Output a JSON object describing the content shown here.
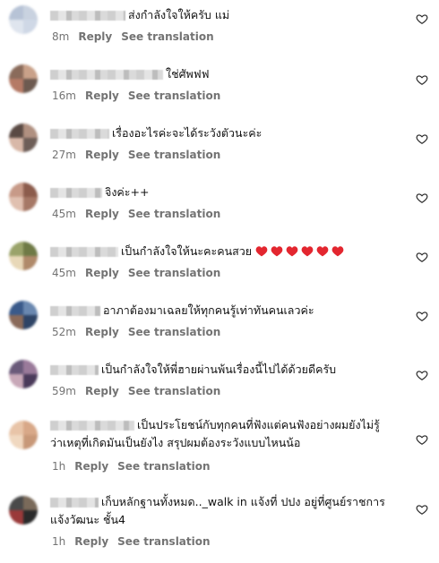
{
  "actions": {
    "reply": "Reply",
    "see_translation": "See translation"
  },
  "comments": [
    {
      "text": "ส่งกำลังใจให้ครับ แม่",
      "time": "8m",
      "avatar": [
        "#b7c3d6",
        "#c9d2e0",
        "#dfe5ee",
        "#cfd8e6"
      ]
    },
    {
      "text": "ใช่ศัพฟฟ",
      "time": "16m",
      "avatar": [
        "#8a6b5b",
        "#c9a189",
        "#b57a66",
        "#6d5a50"
      ]
    },
    {
      "text": "เรื่องอะไรค่ะจะได้ระวังตัวนะค่ะ",
      "time": "27m",
      "avatar": [
        "#5a4a44",
        "#b09080",
        "#d8b8a8",
        "#6e5e58"
      ]
    },
    {
      "text": "จิงค่ะ++",
      "time": "45m",
      "avatar": [
        "#c79a88",
        "#8c5c4c",
        "#e0c0b0",
        "#a67866"
      ]
    },
    {
      "text": "เป็นกำลังใจให้นะคะคนสวย",
      "time": "45m",
      "avatar": [
        "#9aa36a",
        "#6f7a46",
        "#e8d8b8",
        "#b08a6a"
      ],
      "hearts": 6
    },
    {
      "text": "อาภาต้องมาเฉลยให้ทุกคนรู้เท่าทันคนเลวค่ะ",
      "time": "52m",
      "avatar": [
        "#3a5a8a",
        "#6a88b0",
        "#8a6a5a",
        "#2e4466"
      ]
    },
    {
      "text": "เป็นกำลังใจให้พี่ฮายผ่านพ้นเรื่องนี้ไปได้ด้วยดีครับ",
      "time": "59m",
      "avatar": [
        "#6a5a7a",
        "#9a7a9a",
        "#c8a8b8",
        "#4a3a5a"
      ]
    },
    {
      "text": "เป็นประโยชน์กับทุกคนที่ฟังแต่คนฟังอย่างผมยังไม่รู้",
      "text2": "ว่าเหตุที่เกิดมันเป็นยังไง สรุปผมต้องระวังแบบไหนน้อ",
      "time": "1h",
      "avatar": [
        "#e8c4a8",
        "#d8a888",
        "#f0d8c0",
        "#c89878"
      ]
    },
    {
      "text": "เก็บหลักฐานทั้งหมด.._walk in แจ้งที่ ปปง อยู่ที่ศูนย์ราชการ",
      "text2": "แจ้งวัฒนะ ชั้น4",
      "time": "1h",
      "avatar": [
        "#4a4a4a",
        "#7a6a5a",
        "#9a3a3a",
        "#2a2a2a"
      ]
    }
  ],
  "colors": {
    "meta": "#737373",
    "heart_fill": "#e3262f"
  }
}
